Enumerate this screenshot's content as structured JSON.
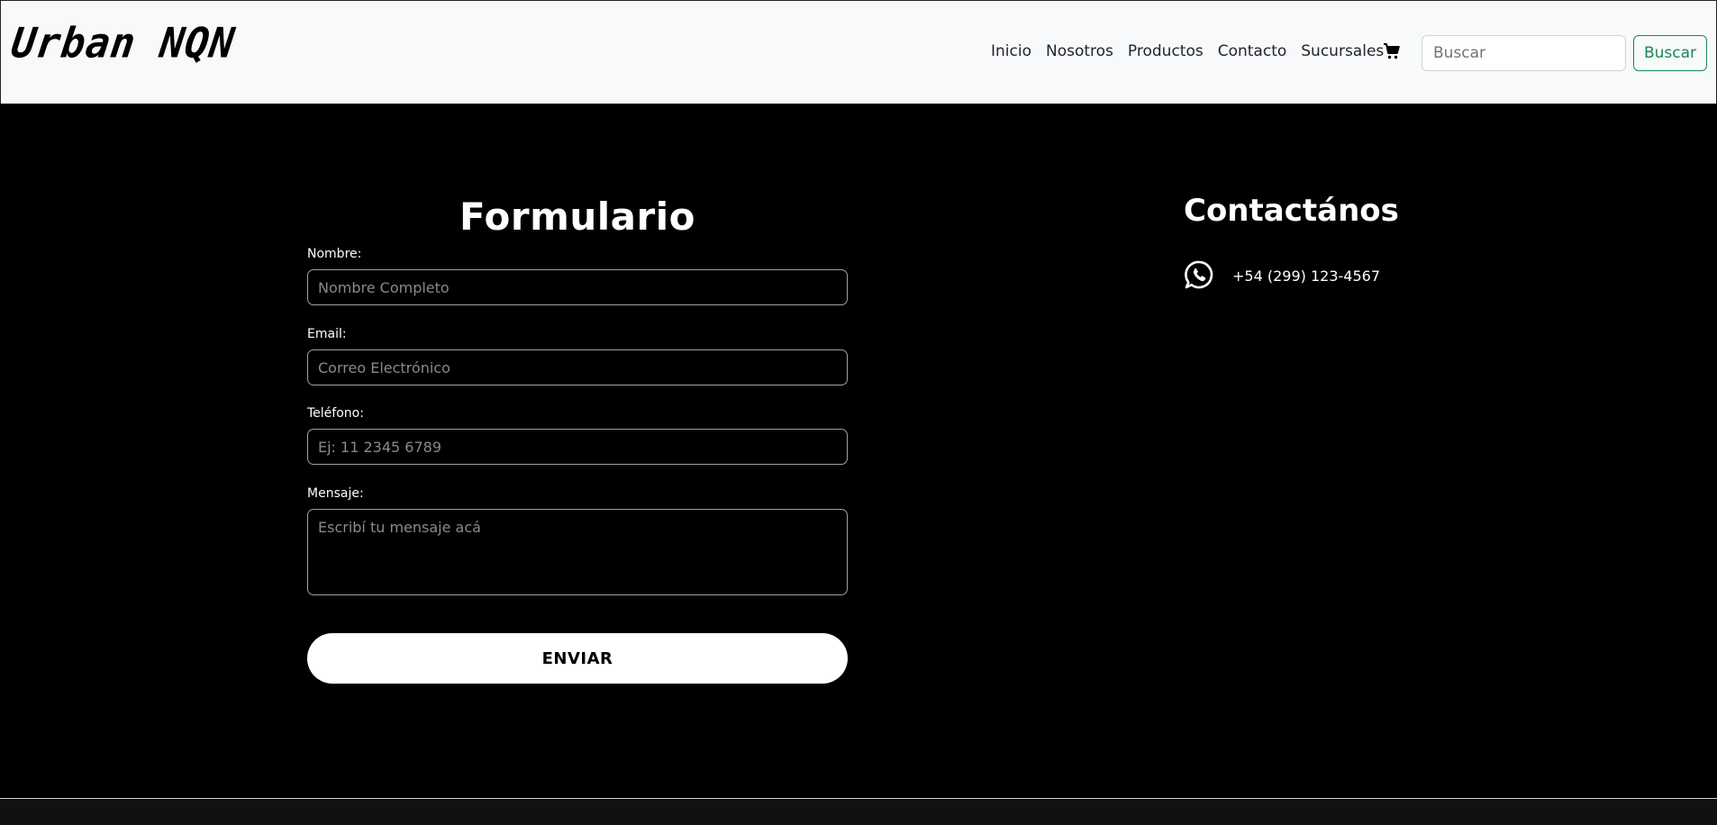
{
  "navbar": {
    "brand": "Urban NQN",
    "links": [
      "Inicio",
      "Nosotros",
      "Productos",
      "Contacto",
      "Sucursales"
    ],
    "cart_icon": "cart-icon",
    "search": {
      "placeholder": "Buscar",
      "value": "",
      "button_label": "Buscar"
    }
  },
  "form": {
    "title": "Formulario",
    "fields": [
      {
        "label": "Nombre:",
        "placeholder": "Nombre Completo"
      },
      {
        "label": "Email:",
        "placeholder": "Correo Electrónico"
      },
      {
        "label": "Teléfono:",
        "placeholder": "Ej: 11 2345 6789"
      },
      {
        "label": "Mensaje:",
        "placeholder": "Escribí tu mensaje acá"
      }
    ],
    "submit_label": "ENVIAR"
  },
  "contact": {
    "title": "Contactános",
    "icon": "whatsapp-icon",
    "phone": "+54 (299) 123-4567"
  },
  "colors": {
    "background": "#000000",
    "navbar_bg": "#f8f9fa",
    "search_button": "#198754"
  }
}
